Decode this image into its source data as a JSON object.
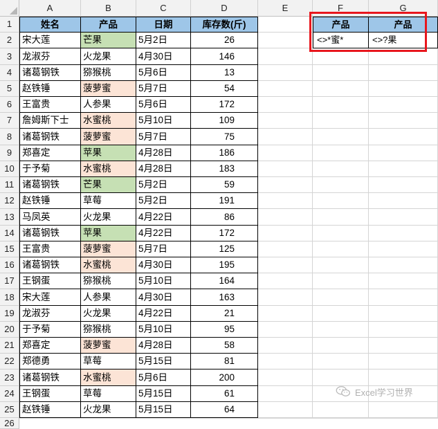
{
  "spreadsheet": {
    "columns": [
      "A",
      "B",
      "C",
      "D",
      "E",
      "F",
      "G"
    ],
    "data_headers": [
      "姓名",
      "产品",
      "日期",
      "库存数(斤)"
    ],
    "rows": [
      {
        "name": "宋大莲",
        "product": "芒果",
        "date": "5月2日",
        "qty": "26",
        "highlight": "green"
      },
      {
        "name": "龙淑芬",
        "product": "火龙果",
        "date": "4月30日",
        "qty": "146",
        "highlight": ""
      },
      {
        "name": "诸葛钢铁",
        "product": "猕猴桃",
        "date": "5月6日",
        "qty": "13",
        "highlight": ""
      },
      {
        "name": "赵铁锤",
        "product": "菠萝蜜",
        "date": "5月7日",
        "qty": "54",
        "highlight": "pink"
      },
      {
        "name": "王富贵",
        "product": "人参果",
        "date": "5月6日",
        "qty": "172",
        "highlight": ""
      },
      {
        "name": "詹姆斯下士",
        "product": "水蜜桃",
        "date": "5月10日",
        "qty": "109",
        "highlight": "pink"
      },
      {
        "name": "诸葛钢铁",
        "product": "菠萝蜜",
        "date": "5月7日",
        "qty": "75",
        "highlight": "pink"
      },
      {
        "name": "郑喜定",
        "product": "苹果",
        "date": "4月28日",
        "qty": "186",
        "highlight": "green"
      },
      {
        "name": "于予菊",
        "product": "水蜜桃",
        "date": "4月28日",
        "qty": "183",
        "highlight": "pink"
      },
      {
        "name": "诸葛钢铁",
        "product": "芒果",
        "date": "5月2日",
        "qty": "59",
        "highlight": "green"
      },
      {
        "name": "赵铁锤",
        "product": "草莓",
        "date": "5月2日",
        "qty": "191",
        "highlight": ""
      },
      {
        "name": "马凤英",
        "product": "火龙果",
        "date": "4月22日",
        "qty": "86",
        "highlight": ""
      },
      {
        "name": "诸葛钢铁",
        "product": "苹果",
        "date": "4月22日",
        "qty": "172",
        "highlight": "green"
      },
      {
        "name": "王富贵",
        "product": "菠萝蜜",
        "date": "5月7日",
        "qty": "125",
        "highlight": "pink"
      },
      {
        "name": "诸葛钢铁",
        "product": "水蜜桃",
        "date": "4月30日",
        "qty": "195",
        "highlight": "pink"
      },
      {
        "name": "王钢蛋",
        "product": "猕猴桃",
        "date": "5月10日",
        "qty": "164",
        "highlight": ""
      },
      {
        "name": "宋大莲",
        "product": "人参果",
        "date": "4月30日",
        "qty": "163",
        "highlight": ""
      },
      {
        "name": "龙淑芬",
        "product": "火龙果",
        "date": "4月22日",
        "qty": "21",
        "highlight": ""
      },
      {
        "name": "于予菊",
        "product": "猕猴桃",
        "date": "5月10日",
        "qty": "95",
        "highlight": ""
      },
      {
        "name": "郑喜定",
        "product": "菠萝蜜",
        "date": "4月28日",
        "qty": "58",
        "highlight": "pink"
      },
      {
        "name": "郑德勇",
        "product": "草莓",
        "date": "5月15日",
        "qty": "81",
        "highlight": ""
      },
      {
        "name": "诸葛钢铁",
        "product": "水蜜桃",
        "date": "5月6日",
        "qty": "200",
        "highlight": "pink"
      },
      {
        "name": "王钢蛋",
        "product": "草莓",
        "date": "5月15日",
        "qty": "61",
        "highlight": ""
      },
      {
        "name": "赵铁锤",
        "product": "火龙果",
        "date": "5月15日",
        "qty": "64",
        "highlight": ""
      }
    ],
    "criteria": {
      "headers": [
        "产品",
        "产品"
      ],
      "values": [
        "<>*蜜*",
        "<>?果"
      ]
    }
  },
  "colors": {
    "header_fill": "#9ec6e8",
    "green": "#c6e0b4",
    "pink": "#fce4d6",
    "annotation_border": "#e8161d"
  },
  "watermark": {
    "text": "Excel学习世界",
    "icon": "wechat-icon"
  }
}
